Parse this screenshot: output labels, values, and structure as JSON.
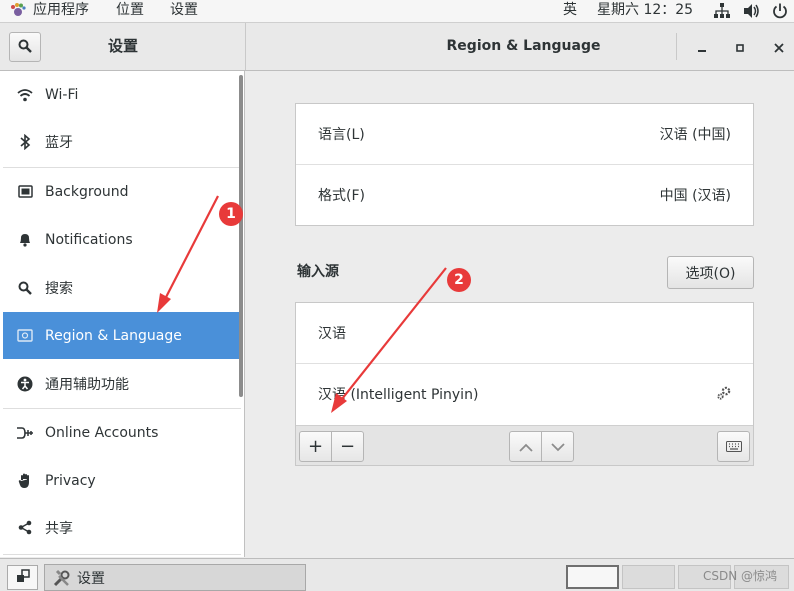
{
  "topbar": {
    "apps_label": "应用程序",
    "places_label": "位置",
    "settings_label": "设置",
    "input_method": "英",
    "datetime": "星期六 12：25"
  },
  "header": {
    "left_title": "设置",
    "title": "Region & Language"
  },
  "sidebar": {
    "items": [
      {
        "label": "Wi-Fi",
        "icon": "wifi-icon"
      },
      {
        "label": "蓝牙",
        "icon": "bluetooth-icon"
      },
      {
        "label": "Background",
        "icon": "background-icon"
      },
      {
        "label": "Notifications",
        "icon": "bell-icon"
      },
      {
        "label": "搜索",
        "icon": "search-icon"
      },
      {
        "label": "Region & Language",
        "icon": "flag-icon"
      },
      {
        "label": "通用辅助功能",
        "icon": "accessibility-icon"
      },
      {
        "label": "Online Accounts",
        "icon": "online-accounts-icon"
      },
      {
        "label": "Privacy",
        "icon": "hand-icon"
      },
      {
        "label": "共享",
        "icon": "share-icon"
      }
    ],
    "selected_index": 5
  },
  "region": {
    "language_label": "语言(L)",
    "language_value": "汉语 (中国)",
    "formats_label": "格式(F)",
    "formats_value": "中国 (汉语)"
  },
  "input_sources": {
    "title": "输入源",
    "options_label": "选项(O)",
    "sources": [
      {
        "name": "汉语"
      },
      {
        "name": "汉语 (Intelligent Pinyin)",
        "has_settings": true
      }
    ],
    "add_label": "+",
    "remove_label": "−"
  },
  "annotations": {
    "badge1": "1",
    "badge2": "2",
    "color": "#e83a3a"
  },
  "taskbar": {
    "task_label": "设置"
  },
  "watermark": "CSDN @惊鸿",
  "colors": {
    "accent": "#4a90d9"
  }
}
